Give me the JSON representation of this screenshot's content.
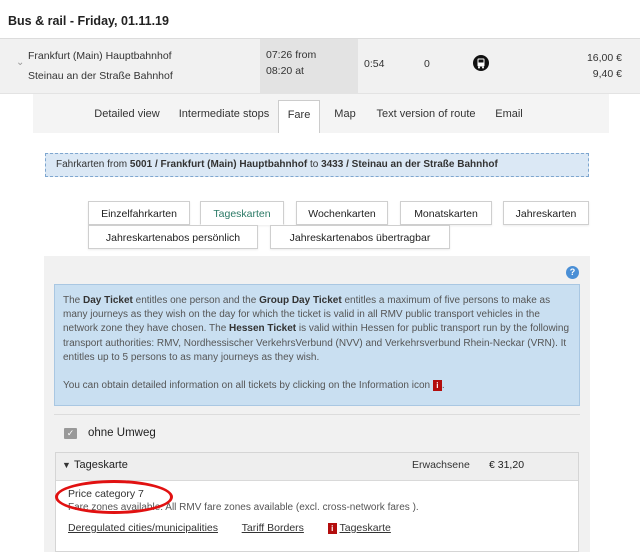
{
  "header": {
    "title": "Bus & rail - Friday, 01.11.19"
  },
  "connection": {
    "from": "Frankfurt (Main) Hauptbahnhof",
    "to": "Steinau an der Straße Bahnhof",
    "time_from": "07:26 from",
    "time_to": "08:20 at",
    "duration": "0:54",
    "changes": "0",
    "price_1": "16,00 €",
    "price_2": "9,40 €",
    "icon": "bus-icon"
  },
  "tabs": [
    {
      "label": "Detailed view"
    },
    {
      "label": "Intermediate stops"
    },
    {
      "label": "Fare",
      "active": true
    },
    {
      "label": "Map"
    },
    {
      "label": "Text version of route"
    },
    {
      "label": "Email"
    }
  ],
  "route": {
    "prefix": "Fahrkarten",
    "from_text": "from",
    "from_code": "5001 / Frankfurt (Main) Hauptbahnhof",
    "to_text": "to",
    "to_code": "3433 / Steinau an der Straße Bahnhof"
  },
  "fare_tabs": [
    {
      "label": "Einzelfahrkarten"
    },
    {
      "label": "Tageskarten",
      "active": true
    },
    {
      "label": "Wochenkarten"
    },
    {
      "label": "Monatskarten"
    },
    {
      "label": "Jahreskarten"
    },
    {
      "label": "Jahreskartenabos persönlich"
    },
    {
      "label": "Jahreskartenabos übertragbar"
    }
  ],
  "info": {
    "t1": "The ",
    "b1": "Day Ticket",
    "t2": " entitles one person and the ",
    "b2": "Group Day Ticket",
    "t3": " entitles a maximum of five persons to make as many journeys as they wish on the day for which the ticket is valid in all RMV public transport vehicles in the network zone they have chosen. The ",
    "b3": "Hessen Ticket",
    "t4": " is valid within Hessen for public transport run by the following transport authorities: RMV, Nordhessischer VerkehrsVerbund (NVV) and Verkehrsverbund Rhein-Neckar (VRN). It entitles up to 5 persons to as many journeys as they wish.",
    "t5": "You can obtain detailed information on all tickets by clicking on the Information icon",
    "t6": ".",
    "icon_glyph": "i"
  },
  "umweg": {
    "label": "ohne Umweg",
    "check": "✓"
  },
  "fare_card": {
    "name": "Tageskarte",
    "category": "Erwachsene",
    "price": "€ 31,20",
    "price_category": "Price category 7",
    "zones": "Fare zones available: All RMV fare zones available (excl. cross-network fares ).",
    "links": {
      "deregulated": "Deregulated cities/municipalities",
      "tariff": "Tariff Borders",
      "ticket": "Tageskarte"
    }
  },
  "help": "?",
  "colors": {
    "accent": "#2b7a66",
    "info_bg": "#c9dff1",
    "route_bg": "#dbe8f5",
    "highlight": "#e11111"
  }
}
